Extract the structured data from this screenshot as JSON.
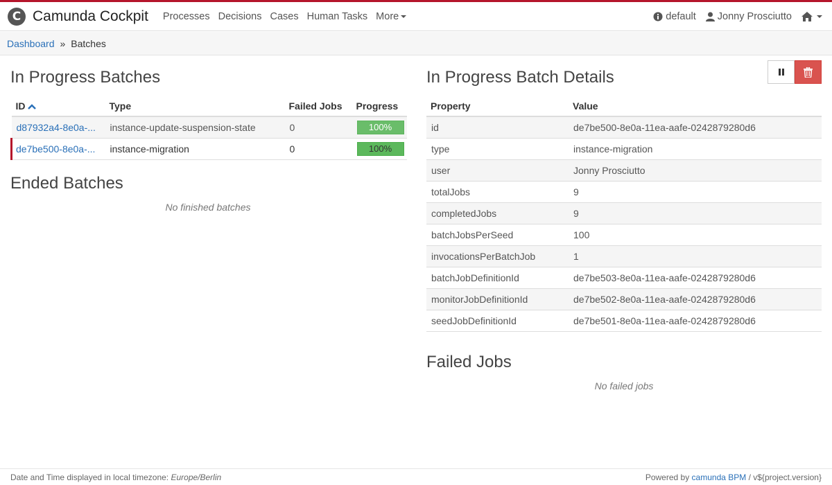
{
  "brand": {
    "name": "Camunda Cockpit",
    "logo_letter": "C"
  },
  "nav": {
    "links": [
      "Processes",
      "Decisions",
      "Cases",
      "Human Tasks"
    ],
    "more_label": "More",
    "engine_label": "default",
    "user_label": "Jonny Prosciutto"
  },
  "breadcrumb": {
    "dashboard": "Dashboard",
    "separator": "»",
    "current": "Batches"
  },
  "in_progress": {
    "title": "In Progress Batches",
    "columns": {
      "id": "ID",
      "type": "Type",
      "failed": "Failed Jobs",
      "progress": "Progress"
    },
    "rows": [
      {
        "id": "d87932a4-8e0a-...",
        "type": "instance-update-suspension-state",
        "failed": "0",
        "progress": "100%"
      },
      {
        "id": "de7be500-8e0a-...",
        "type": "instance-migration",
        "failed": "0",
        "progress": "100%"
      }
    ]
  },
  "ended": {
    "title": "Ended Batches",
    "empty_text": "No finished batches"
  },
  "details": {
    "title": "In Progress Batch Details",
    "columns": {
      "property": "Property",
      "value": "Value"
    },
    "rows": [
      {
        "property": "id",
        "value": "de7be500-8e0a-11ea-aafe-0242879280d6"
      },
      {
        "property": "type",
        "value": "instance-migration"
      },
      {
        "property": "user",
        "value": "Jonny Prosciutto"
      },
      {
        "property": "totalJobs",
        "value": "9"
      },
      {
        "property": "completedJobs",
        "value": "9"
      },
      {
        "property": "batchJobsPerSeed",
        "value": "100"
      },
      {
        "property": "invocationsPerBatchJob",
        "value": "1"
      },
      {
        "property": "batchJobDefinitionId",
        "value": "de7be503-8e0a-11ea-aafe-0242879280d6"
      },
      {
        "property": "monitorJobDefinitionId",
        "value": "de7be502-8e0a-11ea-aafe-0242879280d6"
      },
      {
        "property": "seedJobDefinitionId",
        "value": "de7be501-8e0a-11ea-aafe-0242879280d6"
      }
    ]
  },
  "failed_jobs": {
    "title": "Failed Jobs",
    "empty_text": "No failed jobs"
  },
  "footer": {
    "timezone_prefix": "Date and Time displayed in local timezone:",
    "timezone": "Europe/Berlin",
    "powered_prefix": "Powered by",
    "powered_link": "camunda BPM",
    "version": "/ v${project.version}"
  },
  "colors": {
    "accent": "#b5152b",
    "link": "#2a70b8",
    "progress": "#5cb85c",
    "danger": "#d9534f"
  }
}
